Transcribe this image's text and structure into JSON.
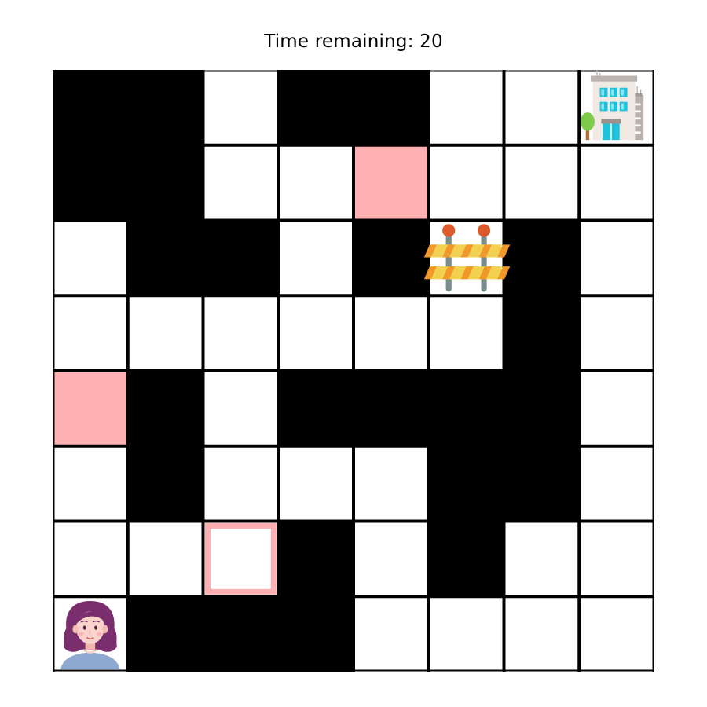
{
  "header": {
    "time_label": "Time remaining: 20"
  },
  "grid": {
    "rows": 8,
    "cols": 8,
    "legend": {
      "W": "wall",
      ".": "open-cell",
      "P": "pink-cell",
      "O": "pink-outlined-cell"
    },
    "cells": [
      [
        "W",
        "W",
        ".",
        "W",
        "W",
        ".",
        ".",
        "."
      ],
      [
        "W",
        "W",
        ".",
        ".",
        "P",
        ".",
        ".",
        "."
      ],
      [
        ".",
        "W",
        "W",
        ".",
        "W",
        ".",
        "W",
        "."
      ],
      [
        ".",
        ".",
        ".",
        ".",
        ".",
        ".",
        "W",
        "."
      ],
      [
        "P",
        "W",
        ".",
        "W",
        "W",
        "W",
        "W",
        "."
      ],
      [
        ".",
        "W",
        ".",
        ".",
        ".",
        "W",
        "W",
        "."
      ],
      [
        ".",
        ".",
        "O",
        "W",
        ".",
        "W",
        ".",
        "."
      ],
      [
        ".",
        "W",
        "W",
        "W",
        ".",
        ".",
        ".",
        "."
      ]
    ],
    "items": [
      {
        "type": "player",
        "icon": "woman-avatar-icon",
        "row": 7,
        "col": 0
      },
      {
        "type": "goal",
        "icon": "office-building-icon",
        "row": 0,
        "col": 7
      },
      {
        "type": "obstacle",
        "icon": "road-barrier-icon",
        "row": 2,
        "col": 5
      }
    ]
  },
  "colors": {
    "wall": "#000000",
    "open": "#ffffff",
    "pink": "#ffb0b2",
    "grid_line": "#000000"
  }
}
